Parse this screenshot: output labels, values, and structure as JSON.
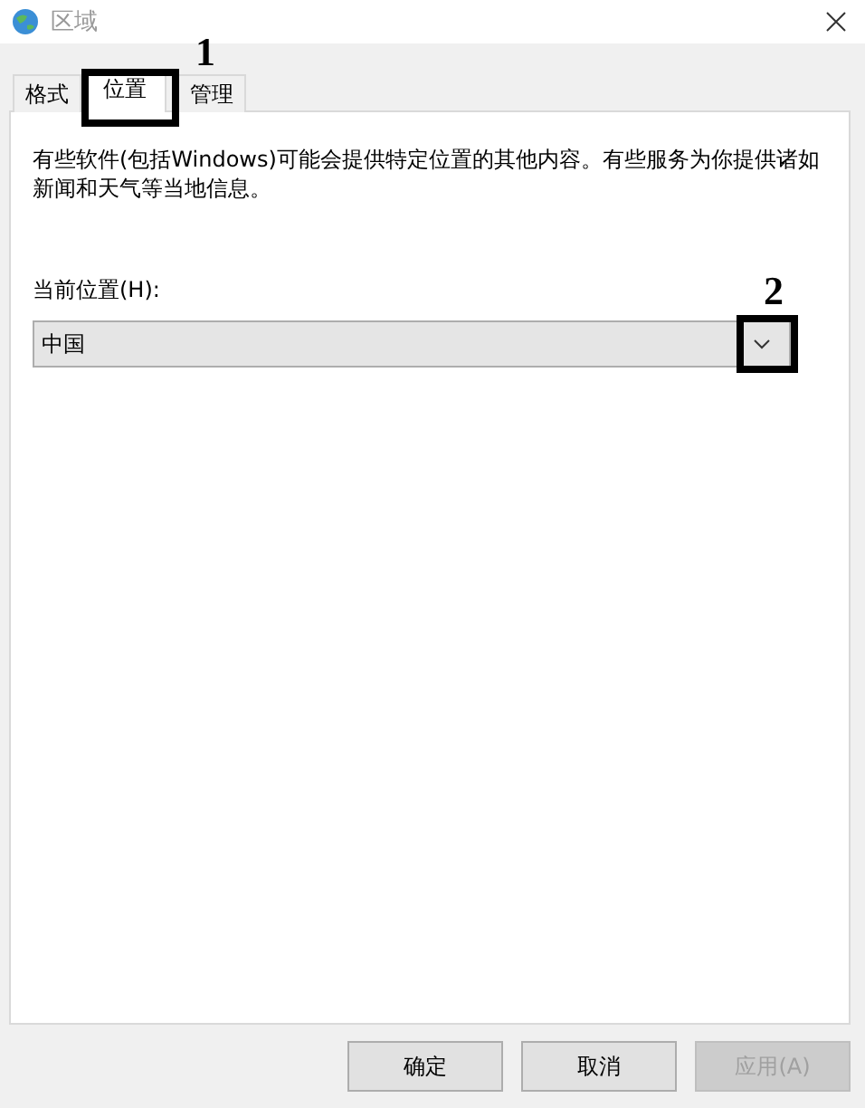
{
  "window": {
    "title": "区域"
  },
  "tabs": [
    {
      "label": "格式",
      "selected": false
    },
    {
      "label": "位置",
      "selected": true,
      "annotation": "1"
    },
    {
      "label": "管理",
      "selected": false
    }
  ],
  "description": "有些软件(包括Windows)可能会提供特定位置的其他内容。有些服务为你提供诸如新闻和天气等当地信息。",
  "location": {
    "label": "当前位置(H):",
    "value": "中国",
    "annotation": "2"
  },
  "buttons": [
    {
      "label": "确定",
      "disabled": false
    },
    {
      "label": "取消",
      "disabled": false
    },
    {
      "label": "应用(A)",
      "disabled": true
    }
  ]
}
